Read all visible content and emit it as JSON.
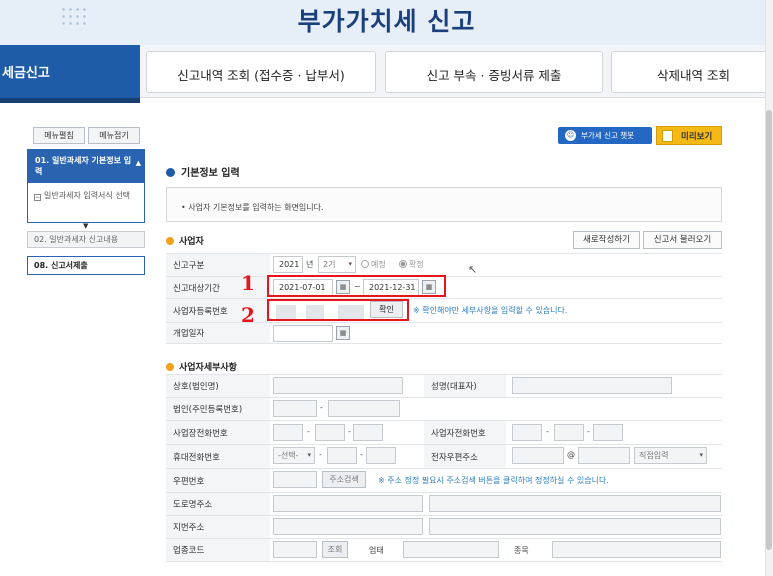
{
  "header": {
    "title": "부가가치세 신고"
  },
  "tabs": {
    "active": "세금신고",
    "items": [
      "신고내역 조회 (접수증 · 납부서)",
      "신고 부속 · 증빙서류 제출",
      "삭제내역 조회"
    ]
  },
  "sidebar": {
    "expand_label": "메뉴펼침",
    "collapse_label": "메뉴접기",
    "items": [
      {
        "label": "01. 일반과세자 기본정보 입력"
      },
      {
        "label": "일반과세자 입력서식 선택"
      },
      {
        "label": "02. 일반과세자 신고내용"
      },
      {
        "label": "08. 신고서제출"
      }
    ]
  },
  "toolbar": {
    "help_label": "부가세 신고 챗봇",
    "preview_label": "미리보기"
  },
  "section": {
    "title": "기본정보 입력",
    "info": "• 사업자 기본정보를 입력하는 화면입니다."
  },
  "business": {
    "title": "사업자",
    "new_label": "새로작성하기",
    "load_label": "신고서 불러오기",
    "report_type_label": "신고구분",
    "year": "2021",
    "year_unit": "년",
    "period": "2기",
    "opt_scheduled": "예정",
    "opt_final": "확정",
    "period_label": "신고대상기간",
    "date_from": "2021-07-01",
    "tilde": "~",
    "date_to": "2021-12-31",
    "regno_label": "사업자등록번호",
    "confirm_label": "확인",
    "confirm_note": "※ 확인해야만 세부사항을 입력할 수 있습니다.",
    "opening_label": "개업일자",
    "annotation_1": "1",
    "annotation_2": "2"
  },
  "details": {
    "title": "사업자세부사항",
    "company_label": "상호(법인명)",
    "rep_label": "성명(대표자)",
    "corp_label": "법인(주민등록번호)",
    "biz_phone_label": "사업장전화번호",
    "biz_tel_label": "사업자전화번호",
    "mobile_label": "휴대전화번호",
    "mobile_select": "-선택-",
    "email_label": "전자우편주소",
    "email_at": "@",
    "email_select": "직접입력",
    "zip_label": "우편번호",
    "zip_search": "주소검색",
    "zip_note": "※ 주소 정정 필요시 주소검색 버튼을 클릭하여 정정하실 수 있습니다.",
    "road_label": "도로명주소",
    "lot_label": "지번주소",
    "industry_label": "업종코드",
    "industry_search": "조회",
    "business_type_label": "업태",
    "category_label": "종목",
    "dash": "-"
  }
}
